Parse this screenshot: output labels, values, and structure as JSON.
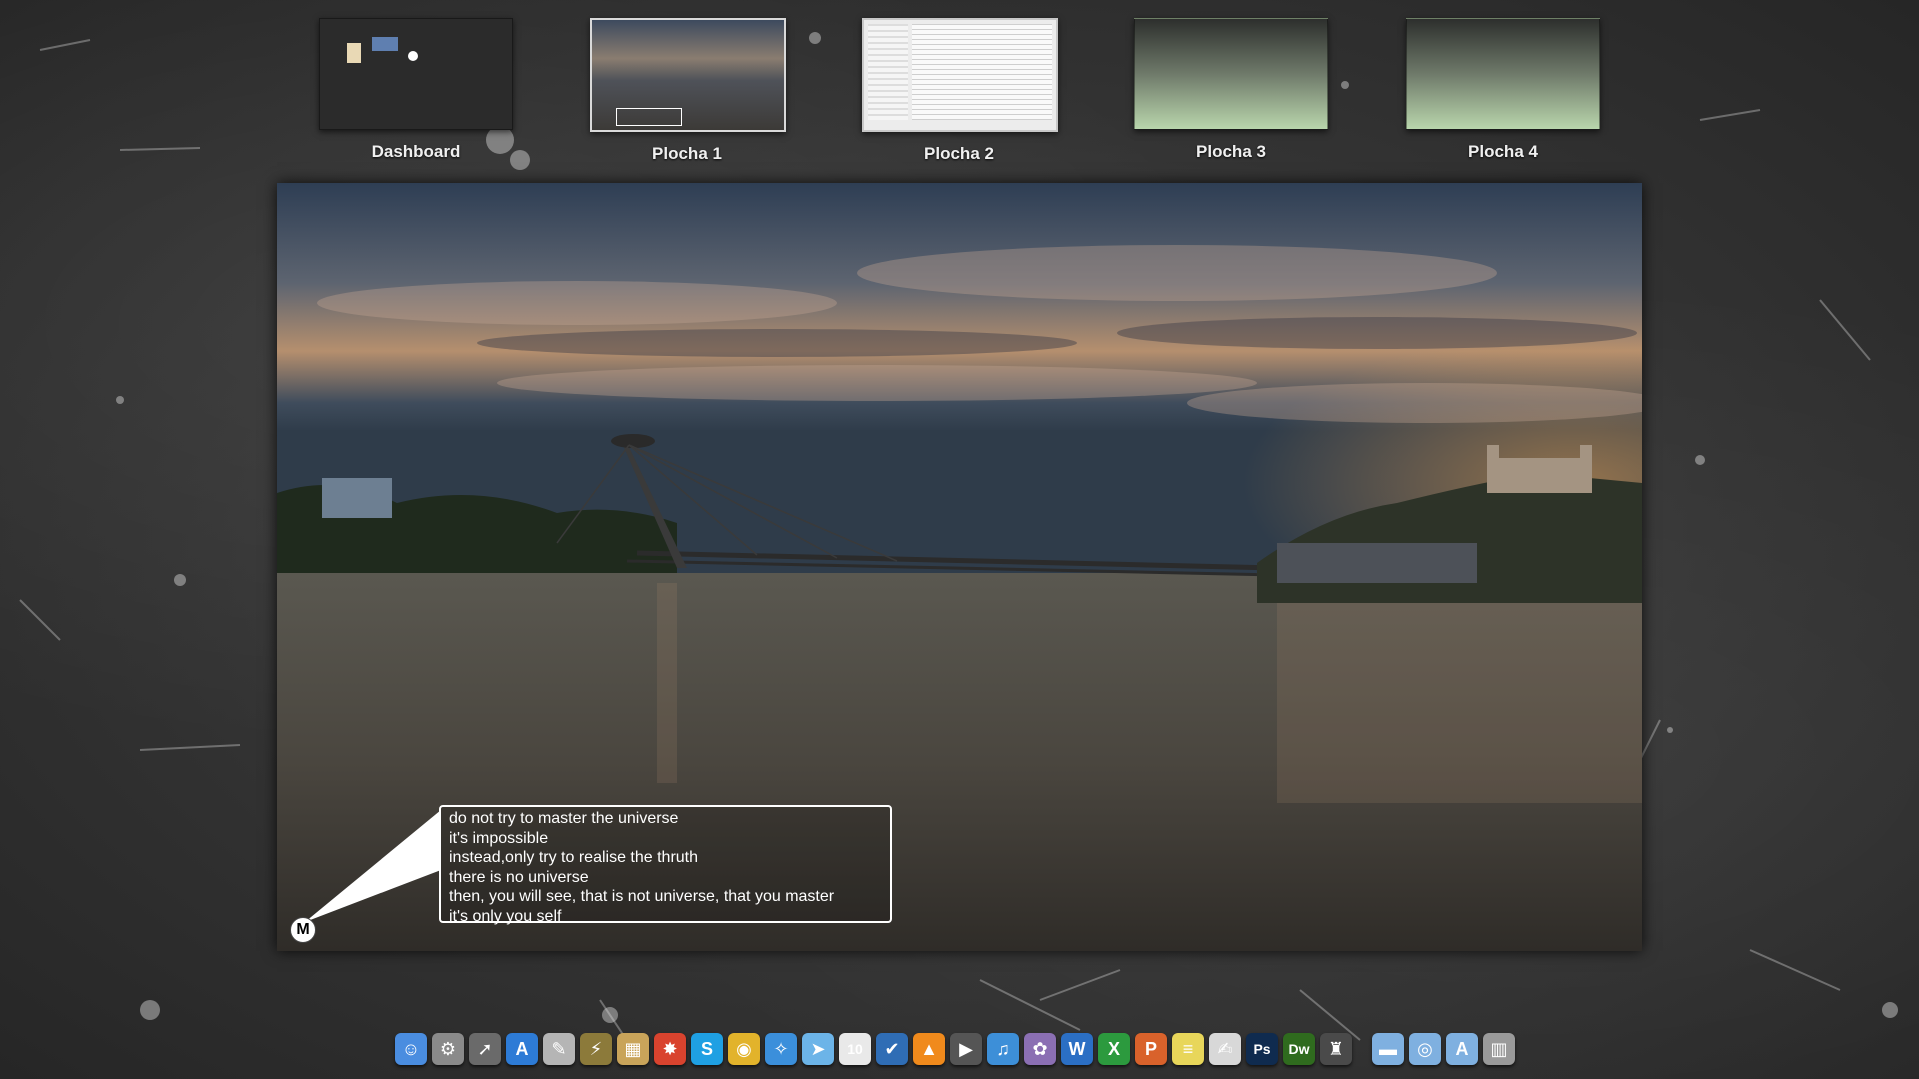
{
  "spaces": [
    {
      "label": "Dashboard"
    },
    {
      "label": "Plocha 1"
    },
    {
      "label": "Plocha 2"
    },
    {
      "label": "Plocha 3"
    },
    {
      "label": "Plocha 4"
    }
  ],
  "quote": {
    "lines": [
      "do not try to master the universe",
      "it's impossible",
      "instead,only try to realise the thruth",
      "there is no universe",
      "then, you will see, that is not universe, that you master",
      "it's only you self"
    ],
    "avatar_letter": "M"
  },
  "dock": {
    "icons": [
      {
        "name": "finder-icon",
        "glyph": "☺",
        "color": "#4a8de0"
      },
      {
        "name": "system-preferences-icon",
        "glyph": "⚙",
        "color": "#8a8a8a"
      },
      {
        "name": "launchpad-icon",
        "glyph": "➚",
        "color": "#6a6a6a"
      },
      {
        "name": "app-store-icon",
        "glyph": "A",
        "color": "#2d7bd6"
      },
      {
        "name": "script-editor-icon",
        "glyph": "✎",
        "color": "#b5b5b5"
      },
      {
        "name": "antenna-icon",
        "glyph": "⚡",
        "color": "#8c7a3a"
      },
      {
        "name": "archive-icon",
        "glyph": "▦",
        "color": "#c9a45a"
      },
      {
        "name": "star-app-icon",
        "glyph": "✸",
        "color": "#d9432e"
      },
      {
        "name": "skype-icon",
        "glyph": "S",
        "color": "#1fa0e3"
      },
      {
        "name": "chrome-icon",
        "glyph": "◉",
        "color": "#e2b32b"
      },
      {
        "name": "safari-icon",
        "glyph": "✧",
        "color": "#3b8fdb"
      },
      {
        "name": "mail-icon",
        "glyph": "➤",
        "color": "#6cb4e8"
      },
      {
        "name": "calendar-icon",
        "glyph": "10",
        "color": "#e9e9e9"
      },
      {
        "name": "tasks-icon",
        "glyph": "✔",
        "color": "#2f6db5"
      },
      {
        "name": "vlc-icon",
        "glyph": "▲",
        "color": "#f08a1c"
      },
      {
        "name": "dvd-player-icon",
        "glyph": "▶",
        "color": "#555555"
      },
      {
        "name": "itunes-icon",
        "glyph": "♫",
        "color": "#3d8fd8"
      },
      {
        "name": "photo-icon",
        "glyph": "✿",
        "color": "#8b6fb3"
      },
      {
        "name": "word-icon",
        "glyph": "W",
        "color": "#2b6fc4"
      },
      {
        "name": "excel-icon",
        "glyph": "X",
        "color": "#2c9a3e"
      },
      {
        "name": "powerpoint-icon",
        "glyph": "P",
        "color": "#d9622b"
      },
      {
        "name": "stickies-icon",
        "glyph": "≡",
        "color": "#e8d65a"
      },
      {
        "name": "textedit-icon",
        "glyph": "✍",
        "color": "#d8d8d8"
      },
      {
        "name": "photoshop-icon",
        "glyph": "Ps",
        "color": "#0f2b4f"
      },
      {
        "name": "dreamweaver-icon",
        "glyph": "Dw",
        "color": "#2f6b1e"
      },
      {
        "name": "robot-icon",
        "glyph": "♜",
        "color": "#4a4a4a"
      },
      {
        "name": "applications-folder-icon",
        "glyph": "▬",
        "color": "#7fb0e0"
      },
      {
        "name": "documents-folder-icon",
        "glyph": "◎",
        "color": "#7fb0e0"
      },
      {
        "name": "downloads-folder-icon",
        "glyph": "A",
        "color": "#7fb0e0"
      },
      {
        "name": "trash-icon",
        "glyph": "▥",
        "color": "#9a9a9a"
      }
    ]
  }
}
